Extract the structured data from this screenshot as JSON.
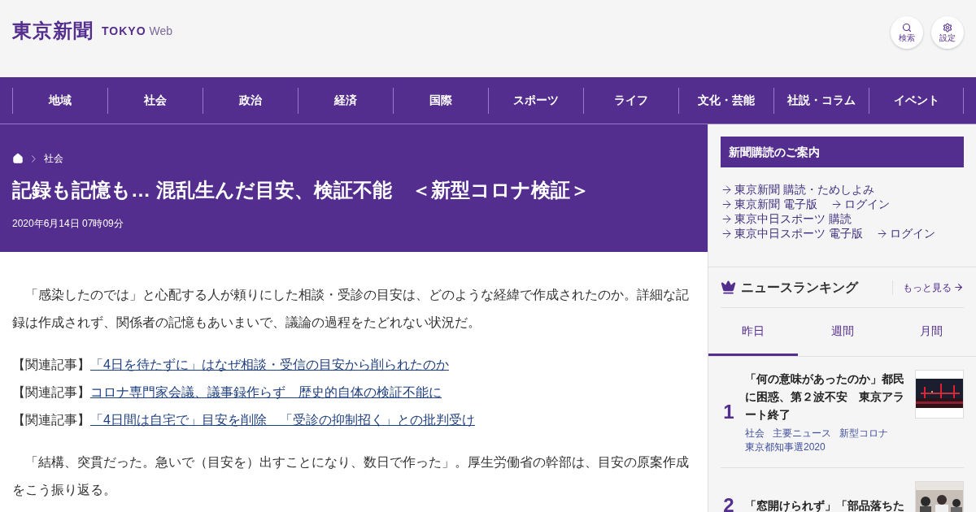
{
  "header": {
    "logo": "東京新聞",
    "logo_sub_bold": "TOKYO",
    "logo_sub_light": "Web",
    "buttons": [
      {
        "kind": "search",
        "label": "検索"
      },
      {
        "kind": "settings",
        "label": "設定"
      }
    ]
  },
  "nav": [
    "地域",
    "社会",
    "政治",
    "経済",
    "国際",
    "スポーツ",
    "ライフ",
    "文化・芸能",
    "社説・コラム",
    "イベント"
  ],
  "article": {
    "breadcrumb": [
      "社会"
    ],
    "title": "記録も記憶も… 混乱生んだ目安、検証不能　＜新型コロナ検証＞",
    "date": "2020年6月14日 07時09分",
    "blocks": [
      {
        "kind": "paragraph",
        "text": "「感染したのでは」と心配する人が頼りにした相談・受診の目安は、どのような経緯で作成されたのか。詳細な記録は作成されず、関係者の記憶もあいまいで、議論の過程をたどれない状況だ。"
      },
      {
        "kind": "related",
        "label": "【関連記事】",
        "link": "「4日を待たずに」はなぜ相談・受信の目安から削られたのか"
      },
      {
        "kind": "related",
        "label": "【関連記事】",
        "link": "コロナ専門家会議、議事録作らず　歴史的自体の検証不能に"
      },
      {
        "kind": "related",
        "label": "【関連記事】",
        "link": "「4日間は自宅で」目安を削除　「受診の抑制招く」との批判受け"
      },
      {
        "kind": "paragraph",
        "text": "「結構、突貫だった。急いで（目安を）出すことになり、数日で作った」。厚生労働省の幹部は、目安の原案作成をこう振り返る。"
      }
    ]
  },
  "sidebar": {
    "subscription": {
      "title": "新聞購読のご案内",
      "rows": [
        {
          "links": [
            "東京新聞 購読・ためしよみ"
          ]
        },
        {
          "links": [
            "東京新聞 電子版",
            "ログイン"
          ]
        },
        {
          "links": [
            "東京中日スポーツ 購読"
          ]
        },
        {
          "links": [
            "東京中日スポーツ 電子版",
            "ログイン"
          ]
        }
      ]
    },
    "ranking": {
      "title": "ニュースランキング",
      "more": "もっと見る",
      "tabs": [
        {
          "label": "昨日",
          "selected": true
        },
        {
          "label": "週間",
          "selected": false
        },
        {
          "label": "月間",
          "selected": false
        }
      ],
      "items": [
        {
          "rank": "1",
          "title": "「何の意味があったのか」都民に困惑、第２波不安　東京アラート終了",
          "tags": [
            "社会",
            "主要ニュース",
            "新型コロナ",
            "東京都知事選2020"
          ]
        },
        {
          "rank": "2",
          "title": "「窓開けられず」「部品落ちた"
        }
      ]
    }
  }
}
